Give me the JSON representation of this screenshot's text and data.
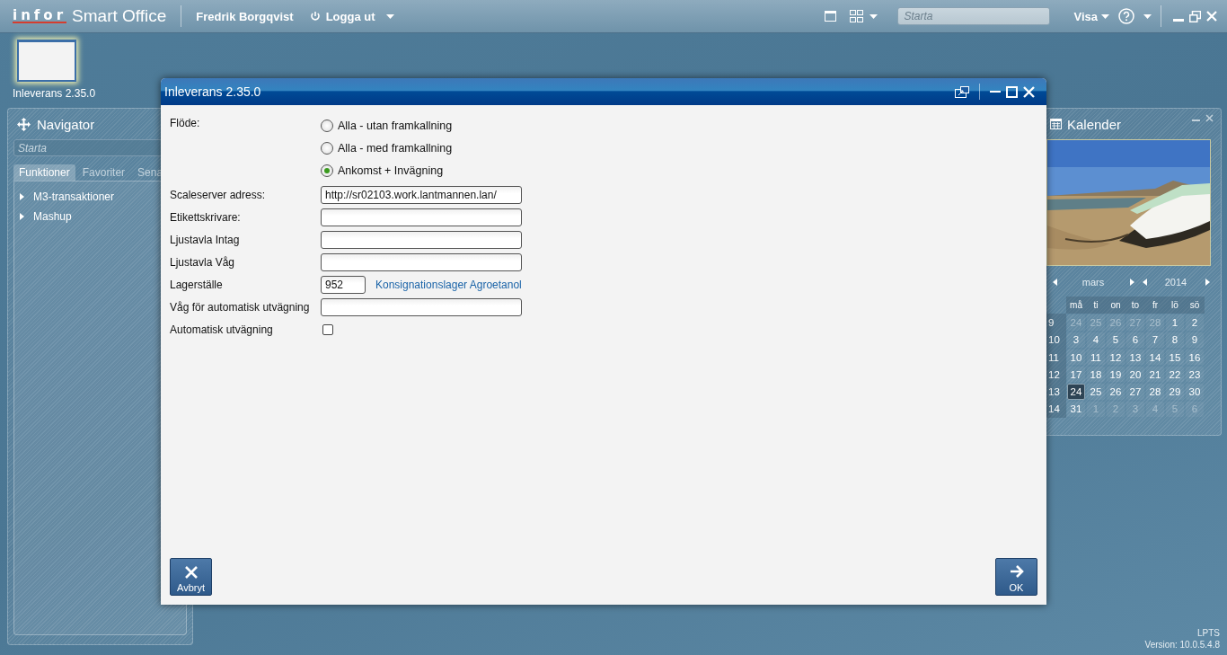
{
  "top_bar": {
    "logo": "infor",
    "product": "Smart Office",
    "user": "Fredrik Borgqvist",
    "logout": "Logga ut",
    "search": {
      "placeholder": "Starta"
    },
    "view_menu": "Visa"
  },
  "task_thumbnail": {
    "label": "Inleverans 2.35.0"
  },
  "navigator": {
    "title": "Navigator",
    "search": {
      "placeholder": "Starta"
    },
    "tabs": [
      {
        "label": "Funktioner",
        "selected": true
      },
      {
        "label": "Favoriter",
        "selected": false
      },
      {
        "label": "Sena",
        "selected": false
      }
    ],
    "items": [
      {
        "label": "M3-transaktioner",
        "expanded": false
      },
      {
        "label": "Mashup",
        "expanded": false
      }
    ]
  },
  "dialog": {
    "title": "Inleverans 2.35.0",
    "flow": {
      "label": "Flöde:",
      "options": [
        {
          "label": "Alla - utan framkallning",
          "selected": false
        },
        {
          "label": "Alla - med framkallning",
          "selected": false
        },
        {
          "label": "Ankomst + Invägning",
          "selected": true
        }
      ]
    },
    "fields": [
      {
        "kind": "text",
        "label": "Scaleserver adress:",
        "value": "http://sr02103.work.lantmannen.lan/"
      },
      {
        "kind": "text",
        "label": "Etikettskrivare:"
      },
      {
        "kind": "text",
        "label": "Ljustavla Intag"
      },
      {
        "kind": "text",
        "label": "Ljustavla Våg"
      },
      {
        "kind": "lookup",
        "label": "Lagerställe",
        "value": "952",
        "link": "Konsignationslager Agroetanol"
      },
      {
        "kind": "text",
        "label": "Våg för automatisk utvägning"
      },
      {
        "kind": "checkbox",
        "label": "Automatisk utvägning",
        "checked": false
      }
    ],
    "buttons": [
      {
        "kind": "cancel",
        "label": "Avbryt"
      },
      {
        "kind": "ok",
        "label": "OK"
      }
    ]
  },
  "calendar": {
    "title": "Kalender",
    "month": "mars",
    "year": "2014",
    "weekdays": [
      "må",
      "ti",
      "on",
      "to",
      "fr",
      "lö",
      "sö"
    ],
    "weeks": [
      {
        "week": "9",
        "days": [
          {
            "day": "24",
            "muted": true,
            "selected": false
          },
          {
            "day": "25",
            "muted": true,
            "selected": false
          },
          {
            "day": "26",
            "muted": true,
            "selected": false
          },
          {
            "day": "27",
            "muted": true,
            "selected": false
          },
          {
            "day": "28",
            "muted": true,
            "selected": false
          },
          {
            "day": "1",
            "muted": false,
            "selected": false
          },
          {
            "day": "2",
            "muted": false,
            "selected": false
          }
        ]
      },
      {
        "week": "10",
        "days": [
          {
            "day": "3",
            "muted": false,
            "selected": false
          },
          {
            "day": "4",
            "muted": false,
            "selected": false
          },
          {
            "day": "5",
            "muted": false,
            "selected": false
          },
          {
            "day": "6",
            "muted": false,
            "selected": false
          },
          {
            "day": "7",
            "muted": false,
            "selected": false
          },
          {
            "day": "8",
            "muted": false,
            "selected": false
          },
          {
            "day": "9",
            "muted": false,
            "selected": false
          }
        ]
      },
      {
        "week": "11",
        "days": [
          {
            "day": "10",
            "muted": false,
            "selected": false
          },
          {
            "day": "11",
            "muted": false,
            "selected": false
          },
          {
            "day": "12",
            "muted": false,
            "selected": false
          },
          {
            "day": "13",
            "muted": false,
            "selected": false
          },
          {
            "day": "14",
            "muted": false,
            "selected": false
          },
          {
            "day": "15",
            "muted": false,
            "selected": false
          },
          {
            "day": "16",
            "muted": false,
            "selected": false
          }
        ]
      },
      {
        "week": "12",
        "days": [
          {
            "day": "17",
            "muted": false,
            "selected": false
          },
          {
            "day": "18",
            "muted": false,
            "selected": false
          },
          {
            "day": "19",
            "muted": false,
            "selected": false
          },
          {
            "day": "20",
            "muted": false,
            "selected": false
          },
          {
            "day": "21",
            "muted": false,
            "selected": false
          },
          {
            "day": "22",
            "muted": false,
            "selected": false
          },
          {
            "day": "23",
            "muted": false,
            "selected": false
          }
        ]
      },
      {
        "week": "13",
        "days": [
          {
            "day": "24",
            "muted": false,
            "selected": true
          },
          {
            "day": "25",
            "muted": false,
            "selected": false
          },
          {
            "day": "26",
            "muted": false,
            "selected": false
          },
          {
            "day": "27",
            "muted": false,
            "selected": false
          },
          {
            "day": "28",
            "muted": false,
            "selected": false
          },
          {
            "day": "29",
            "muted": false,
            "selected": false
          },
          {
            "day": "30",
            "muted": false,
            "selected": false
          }
        ]
      },
      {
        "week": "14",
        "days": [
          {
            "day": "31",
            "muted": false,
            "selected": false
          },
          {
            "day": "1",
            "muted": true,
            "selected": false
          },
          {
            "day": "2",
            "muted": true,
            "selected": false
          },
          {
            "day": "3",
            "muted": true,
            "selected": false
          },
          {
            "day": "4",
            "muted": true,
            "selected": false
          },
          {
            "day": "5",
            "muted": true,
            "selected": false
          },
          {
            "day": "6",
            "muted": true,
            "selected": false
          }
        ]
      }
    ]
  },
  "footer": {
    "server": "LPTS",
    "version": "Version: 10.0.5.4.8"
  }
}
